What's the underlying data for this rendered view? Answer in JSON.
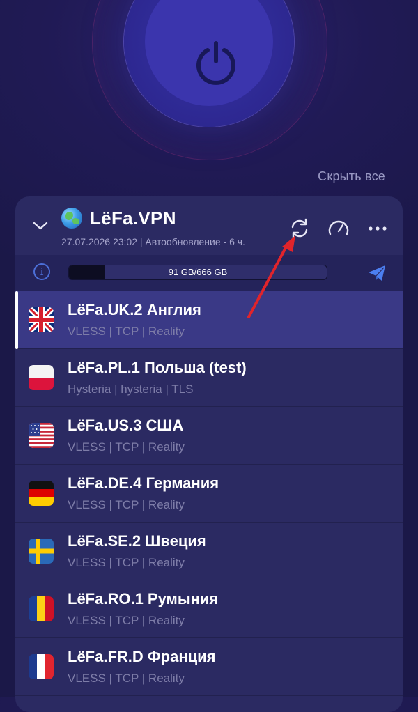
{
  "header": {
    "hide_all": "Скрыть все"
  },
  "subscription": {
    "title": "LёFa.VPN",
    "subtitle": "27.07.2026 23:02 | Автообновление - 6 ч.",
    "traffic_text": "91 GB/666 GB",
    "traffic_used_fraction": 0.14
  },
  "servers": [
    {
      "name": "LёFa.UK.2 Англия",
      "protocol": "VLESS | TCP | Reality",
      "flag": "uk",
      "active": true
    },
    {
      "name": "LёFa.PL.1 Польша (test)",
      "protocol": "Hysteria | hysteria | TLS",
      "flag": "pl",
      "active": false
    },
    {
      "name": "LёFa.US.3 США",
      "protocol": "VLESS | TCP | Reality",
      "flag": "us",
      "active": false
    },
    {
      "name": "LёFa.DE.4 Германия",
      "protocol": "VLESS | TCP | Reality",
      "flag": "de",
      "active": false
    },
    {
      "name": "LёFa.SE.2 Швеция",
      "protocol": "VLESS | TCP | Reality",
      "flag": "se",
      "active": false
    },
    {
      "name": "LёFa.RO.1 Румыния",
      "protocol": "VLESS | TCP | Reality",
      "flag": "ro",
      "active": false
    },
    {
      "name": "LёFa.FR.D Франция",
      "protocol": "VLESS | TCP | Reality",
      "flag": "fr",
      "active": false
    }
  ],
  "icons": {
    "power": "power-icon",
    "chevron": "chevron-down-icon",
    "refresh": "refresh-icon",
    "speed": "speedometer-icon",
    "more": "more-icon",
    "info": "info-icon",
    "telegram": "telegram-icon"
  },
  "colors": {
    "accent": "#4c6fd8",
    "annotation_arrow": "#e0242b",
    "active_row": "#3a3986"
  }
}
